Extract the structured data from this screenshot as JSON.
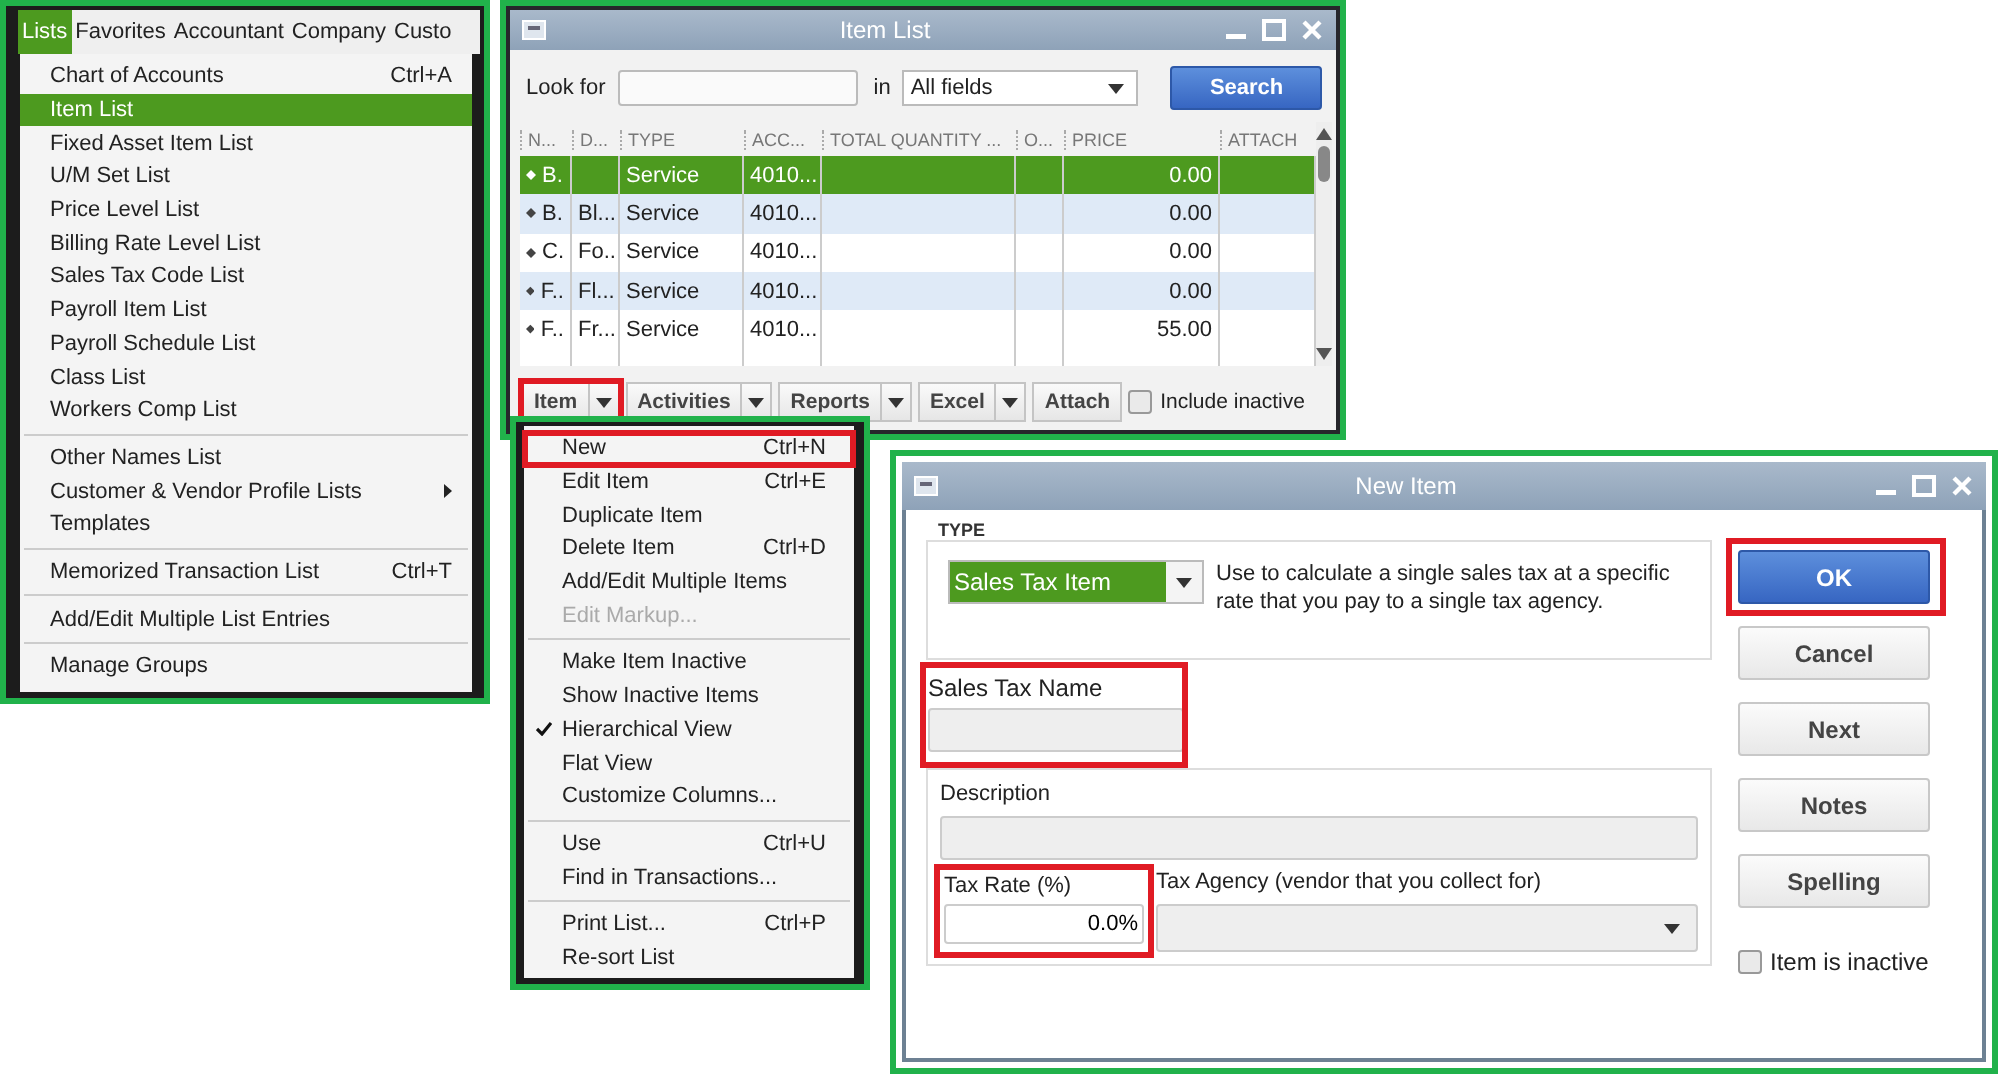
{
  "lists_menu": {
    "menubar": [
      {
        "label": "Lists",
        "selected": true
      },
      {
        "label": "Favorites",
        "selected": false
      },
      {
        "label": "Accountant",
        "selected": false
      },
      {
        "label": "Company",
        "selected": false
      },
      {
        "label": "Custo",
        "selected": false
      }
    ],
    "groups": [
      [
        {
          "label": "Chart of Accounts",
          "shortcut": "Ctrl+A",
          "selected": false
        },
        {
          "label": "Item List",
          "selected": true
        },
        {
          "label": "Fixed Asset Item List",
          "selected": false
        },
        {
          "label": "U/M Set List",
          "selected": false
        },
        {
          "label": "Price Level List",
          "selected": false
        },
        {
          "label": "Billing Rate Level List",
          "selected": false
        },
        {
          "label": "Sales Tax Code List",
          "selected": false
        },
        {
          "label": "Payroll Item List",
          "selected": false
        },
        {
          "label": "Payroll Schedule List",
          "selected": false
        },
        {
          "label": "Class List",
          "selected": false
        },
        {
          "label": "Workers Comp List",
          "selected": false
        }
      ],
      [
        {
          "label": "Other Names List",
          "selected": false
        },
        {
          "label": "Customer & Vendor Profile Lists",
          "selected": false,
          "submenu": true
        },
        {
          "label": "Templates",
          "selected": false
        }
      ],
      [
        {
          "label": "Memorized Transaction List",
          "shortcut": "Ctrl+T",
          "selected": false
        }
      ],
      [
        {
          "label": "Add/Edit Multiple List Entries",
          "selected": false
        }
      ],
      [
        {
          "label": "Manage Groups",
          "selected": false
        }
      ]
    ]
  },
  "item_list": {
    "title": "Item List",
    "look_for_label": "Look for",
    "in_label": "in",
    "search_in": "All fields",
    "search_button": "Search",
    "columns": [
      "N...",
      "D...",
      "TYPE",
      "ACC...",
      "TOTAL QUANTITY ...",
      "O...",
      "PRICE",
      "ATTACH"
    ],
    "rows": [
      {
        "cells": [
          "B.",
          "",
          "Service",
          "4010...",
          "",
          "",
          "0.00",
          ""
        ],
        "selected": true
      },
      {
        "cells": [
          "B.",
          "Bl...",
          "Service",
          "4010...",
          "",
          "",
          "0.00",
          ""
        ],
        "selected": false
      },
      {
        "cells": [
          "C.",
          "Fo...",
          "Service",
          "4010...",
          "",
          "",
          "0.00",
          ""
        ],
        "selected": false
      },
      {
        "cells": [
          "F..",
          "Fl...",
          "Service",
          "4010...",
          "",
          "",
          "0.00",
          ""
        ],
        "selected": false
      },
      {
        "cells": [
          "F..",
          "Fr...",
          "Service",
          "4010...",
          "",
          "",
          "55.00",
          ""
        ],
        "selected": false
      }
    ],
    "toolbar": [
      {
        "label": "Item",
        "highlighted": true,
        "dropdown": true
      },
      {
        "label": "Activities",
        "highlighted": false,
        "dropdown": true
      },
      {
        "label": "Reports",
        "highlighted": false,
        "dropdown": true
      },
      {
        "label": "Excel",
        "highlighted": false,
        "dropdown": true
      },
      {
        "label": "Attach",
        "highlighted": false,
        "dropdown": false
      }
    ],
    "include_inactive": {
      "label": "Include inactive",
      "checked": false
    }
  },
  "item_menu": {
    "groups": [
      [
        {
          "label": "New",
          "shortcut": "Ctrl+N",
          "highlighted": true,
          "disabled": false,
          "checked": false
        },
        {
          "label": "Edit Item",
          "shortcut": "Ctrl+E",
          "highlighted": false,
          "disabled": false,
          "checked": false
        },
        {
          "label": "Duplicate Item",
          "highlighted": false,
          "disabled": false,
          "checked": false
        },
        {
          "label": "Delete Item",
          "shortcut": "Ctrl+D",
          "highlighted": false,
          "disabled": false,
          "checked": false
        },
        {
          "label": "Add/Edit Multiple Items",
          "highlighted": false,
          "disabled": false,
          "checked": false
        },
        {
          "label": "Edit Markup...",
          "highlighted": false,
          "disabled": true,
          "checked": false
        }
      ],
      [
        {
          "label": "Make Item Inactive",
          "highlighted": false,
          "disabled": false,
          "checked": false
        },
        {
          "label": "Show Inactive Items",
          "highlighted": false,
          "disabled": false,
          "checked": false
        },
        {
          "label": "Hierarchical View",
          "highlighted": false,
          "disabled": false,
          "checked": true
        },
        {
          "label": "Flat View",
          "highlighted": false,
          "disabled": false,
          "checked": false
        },
        {
          "label": "Customize Columns...",
          "highlighted": false,
          "disabled": false,
          "checked": false
        }
      ],
      [
        {
          "label": "Use",
          "shortcut": "Ctrl+U",
          "highlighted": false,
          "disabled": false,
          "checked": false
        },
        {
          "label": "Find in Transactions...",
          "highlighted": false,
          "disabled": false,
          "checked": false
        }
      ],
      [
        {
          "label": "Print List...",
          "shortcut": "Ctrl+P",
          "highlighted": false,
          "disabled": false,
          "checked": false
        },
        {
          "label": "Re-sort List",
          "highlighted": false,
          "disabled": false,
          "checked": false
        }
      ]
    ]
  },
  "new_item": {
    "title": "New Item",
    "type_legend": "TYPE",
    "type_value": "Sales Tax Item",
    "type_description": "Use to calculate a single sales tax at a specific rate that you pay to a single tax agency.",
    "sales_tax_name": {
      "label": "Sales Tax Name",
      "highlighted": true
    },
    "description": {
      "label": "Description"
    },
    "tax_rate": {
      "label": "Tax Rate (%)",
      "value": "0.0%",
      "highlighted": true
    },
    "tax_agency": {
      "label": "Tax Agency (vendor that you collect for)"
    },
    "buttons": [
      {
        "label": "OK",
        "primary": true,
        "highlighted": true
      },
      {
        "label": "Cancel",
        "primary": false,
        "highlighted": false
      },
      {
        "label": "Next",
        "primary": false,
        "highlighted": false
      },
      {
        "label": "Notes",
        "primary": false,
        "highlighted": false
      },
      {
        "label": "Spelling",
        "primary": false,
        "highlighted": false
      }
    ],
    "inactive": {
      "label": "Item is inactive",
      "checked": false
    }
  }
}
